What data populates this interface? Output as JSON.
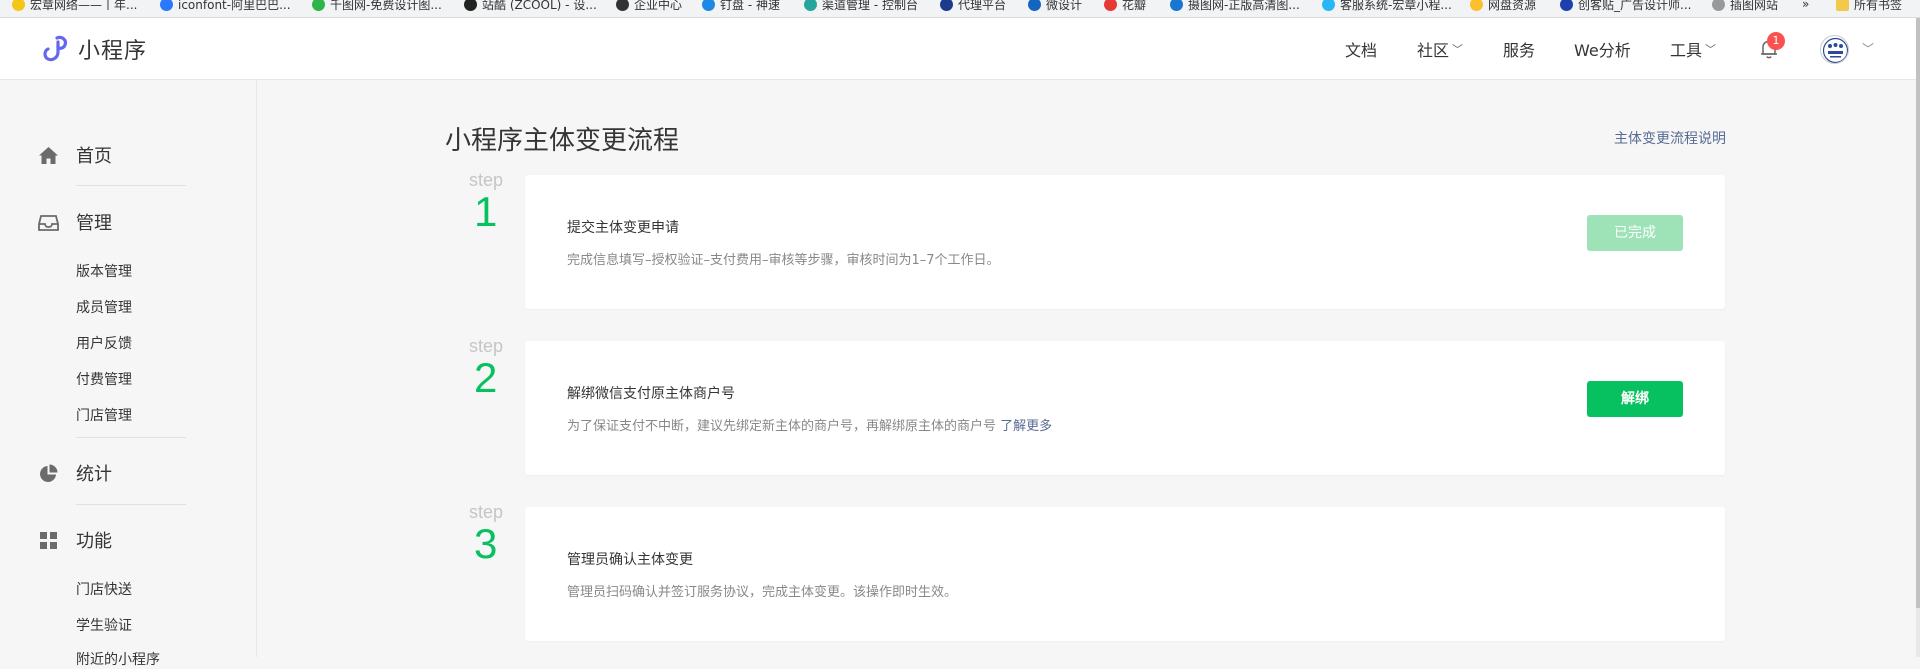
{
  "bookmarks": [
    {
      "label": "宏章网络——丨年...",
      "color": "#f5c518"
    },
    {
      "label": "iconfont-阿里巴巴...",
      "color": "#2979ff"
    },
    {
      "label": "千图网-免费设计图...",
      "color": "#2fb44a"
    },
    {
      "label": "站酷 (ZCOOL) - 设...",
      "color": "#222222"
    },
    {
      "label": "企业中心",
      "color": "#333333"
    },
    {
      "label": "钉盘 - 神速",
      "color": "#1e88e5"
    },
    {
      "label": "渠道管理 - 控制台",
      "color": "#26a69a"
    },
    {
      "label": "代理平台",
      "color": "#1e3a8a"
    },
    {
      "label": "微设计",
      "color": "#1565c0"
    },
    {
      "label": "花瓣",
      "color": "#e53935"
    },
    {
      "label": "摄图网-正版高清图...",
      "color": "#1976d2"
    },
    {
      "label": "客服系统-宏章小程...",
      "color": "#29b6f6"
    },
    {
      "label": "网盘资源",
      "color": "#fbc02d"
    },
    {
      "label": "创客贴_广告设计师...",
      "color": "#1e40af"
    },
    {
      "label": "插图网站",
      "color": "#999999"
    }
  ],
  "bookmarks_more": "»",
  "bookmarks_all": "所有书签",
  "app": {
    "name": "小程序",
    "brand_color": "#6467f0"
  },
  "nav": [
    {
      "label": "文档",
      "has_dropdown": false
    },
    {
      "label": "社区",
      "has_dropdown": true
    },
    {
      "label": "服务",
      "has_dropdown": false
    },
    {
      "label": "We分析",
      "has_dropdown": false
    },
    {
      "label": "工具",
      "has_dropdown": true
    }
  ],
  "notifications": {
    "count": "1"
  },
  "sidebar": {
    "home": "首页",
    "manage": "管理",
    "manage_items": [
      "版本管理",
      "成员管理",
      "用户反馈",
      "付费管理",
      "门店管理"
    ],
    "stats": "统计",
    "features": "功能",
    "feature_items": [
      "门店快送",
      "学生验证",
      "附近的小程序"
    ]
  },
  "page": {
    "title": "小程序主体变更流程",
    "help_link": "主体变更流程说明"
  },
  "steps": [
    {
      "word": "step",
      "number": "1",
      "title": "提交主体变更申请",
      "desc": "完成信息填写–授权验证–支付费用–审核等步骤，审核时间为1–7个工作日。",
      "more": "",
      "button": "已完成",
      "button_state": "done"
    },
    {
      "word": "step",
      "number": "2",
      "title": "解绑微信支付原主体商户号",
      "desc": "为了保证支付不中断，建议先绑定新主体的商户号，再解绑原主体的商户号 ",
      "more": "了解更多",
      "button": "解绑",
      "button_state": "primary"
    },
    {
      "word": "step",
      "number": "3",
      "title": "管理员确认主体变更",
      "desc": "管理员扫码确认并签订服务协议，完成主体变更。该操作即时生效。",
      "more": "",
      "button": "",
      "button_state": "none"
    }
  ],
  "colors": {
    "accent": "#07c160",
    "accent_disabled": "#9ee3b8",
    "link": "#576b95",
    "badge": "#fa5151"
  }
}
